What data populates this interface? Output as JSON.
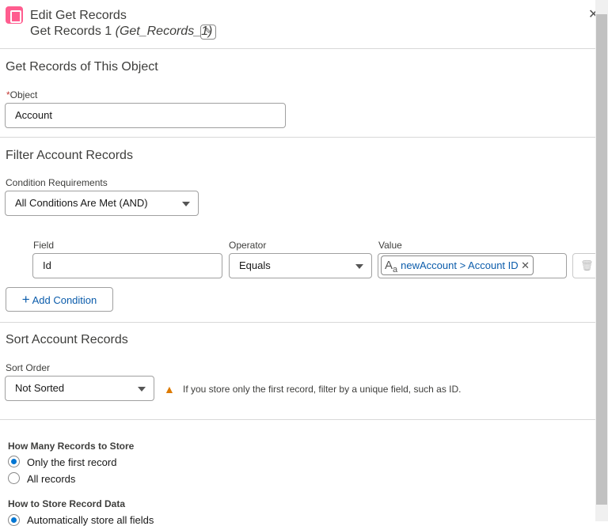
{
  "header": {
    "title": "Edit Get Records",
    "subtitle": "Get Records 1",
    "api_name": "(Get_Records_1)",
    "edit_icon": "pencil-icon",
    "close_icon": "close-icon"
  },
  "object_section": {
    "heading": "Get Records of This Object",
    "required_mark": "*",
    "object_label": "Object",
    "object_value": "Account"
  },
  "filter_section": {
    "heading": "Filter Account Records",
    "condition_label": "Condition Requirements",
    "condition_value": "All Conditions Are Met (AND)",
    "columns": {
      "field": "Field",
      "operator": "Operator",
      "value": "Value"
    },
    "row": {
      "field": "Id",
      "operator": "Equals",
      "value": "newAccount > Account ID"
    },
    "add_condition": "Add Condition"
  },
  "sort_section": {
    "heading": "Sort Account Records",
    "sort_label": "Sort Order",
    "sort_value": "Not Sorted",
    "warning": "If you store only the first record, filter by a unique field, such as ID.",
    "warning_color": "#dd7a01"
  },
  "store": {
    "how_many_heading": "How Many Records to Store",
    "options": [
      "Only the first record",
      "All records"
    ],
    "selected": 0,
    "how_store_heading": "How to Store Record Data",
    "store_option": "Automatically store all fields"
  },
  "colors": {
    "accent": "#0176d3",
    "icon": "#ff5d8f"
  }
}
